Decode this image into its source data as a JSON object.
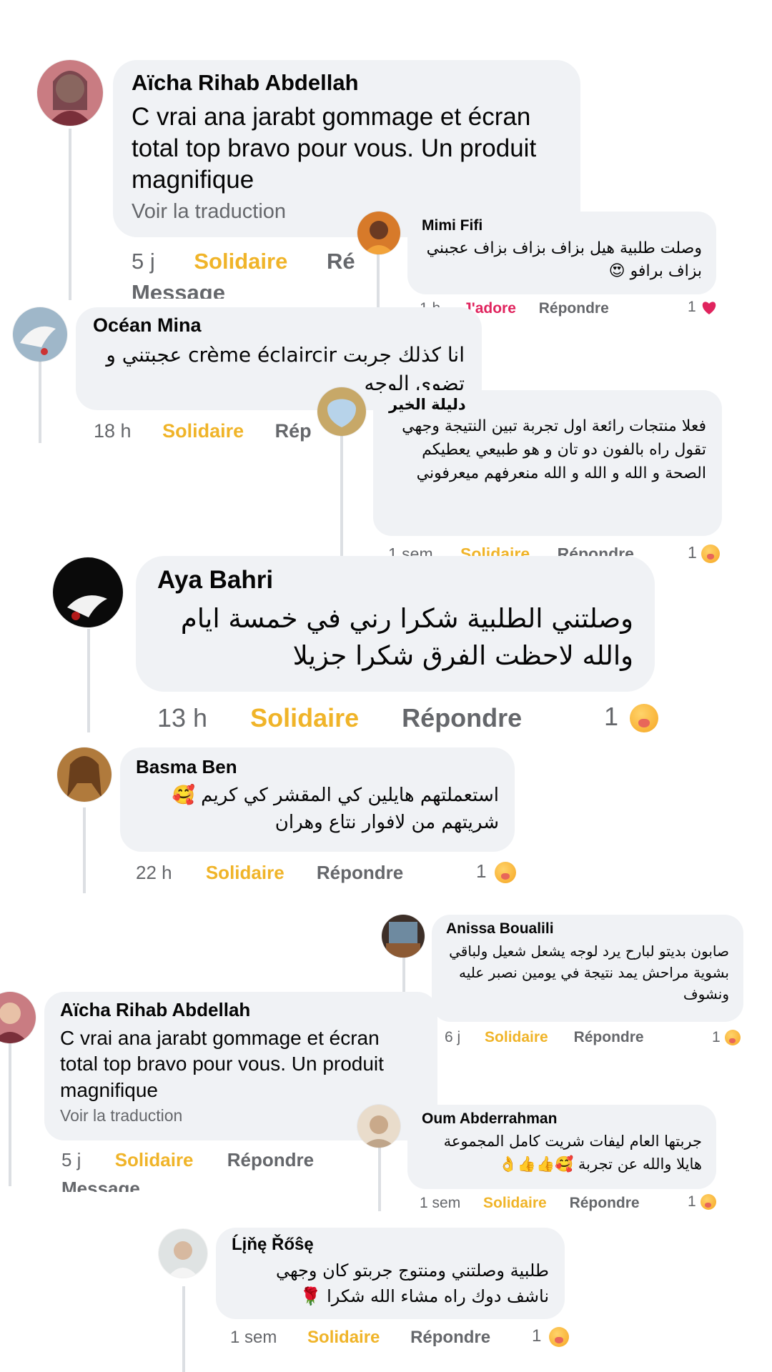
{
  "comments": [
    {
      "name": "Aïcha Rihab Abdellah",
      "text": "C vrai ana jarabt gommage et écran total top bravo pour vous. Un produit magnifique",
      "translate": "Voir la traduction",
      "time": "5 j",
      "solidaire": "Solidaire",
      "reply": "Ré",
      "overflow": "Message"
    },
    {
      "name": "Mimi Fifi",
      "text": "وصلت طلبية هيل بزاف بزاف بزاف عجبني بزاف برافو 😍",
      "time": "1 h",
      "react_label": "J'adore",
      "reply": "Répondre",
      "count": "1",
      "react_color": "#e0245e"
    },
    {
      "name": "Océan Mina",
      "text": "انا كذلك جربت crème éclaircir عجبتني و تضوي الوجه",
      "time": "18 h",
      "solidaire": "Solidaire",
      "reply": "Rép"
    },
    {
      "name": "دليلة الخير",
      "text": "فعلا منتجات رائعة اول تجربة تبين النتيجة وجهي تقول راه بالفون دو تان و هو طبيعي يعطيكم الصحة و الله و الله و الله منعرفهم ميعرفوني",
      "time": "1 sem",
      "solidaire": "Solidaire",
      "reply": "Répondre",
      "count": "1"
    },
    {
      "name": "Aya Bahri",
      "text": "وصلتني الطلبية شكرا رني في خمسة ايام والله لاحظت الفرق شكرا جزيلا",
      "time": "13 h",
      "solidaire": "Solidaire",
      "reply": "Répondre",
      "count": "1"
    },
    {
      "name": "Basma Ben",
      "text": "استعملتهم هايلين كي المقشر كي كريم 🥰 شريتهم من لافوار نتاع وهران",
      "time": "22 h",
      "solidaire": "Solidaire",
      "reply": "Répondre",
      "count": "1"
    },
    {
      "name": "Anissa Boualili",
      "text": "صابون بديتو لبارح يرد لوجه يشعل شعيل ولباقي بشوية مراحش يمد نتيجة في يومين نصبر عليه ونشوف",
      "time": "6 j",
      "solidaire": "Solidaire",
      "reply": "Répondre",
      "count": "1"
    },
    {
      "name": "Aïcha Rihab Abdellah",
      "text": "C vrai ana jarabt gommage et écran total top bravo pour vous. Un produit magnifique",
      "translate": "Voir la traduction",
      "time": "5 j",
      "solidaire": "Solidaire",
      "reply": "Répondre",
      "overflow": "Message"
    },
    {
      "name": "Oum Abderrahman",
      "text": "جربتها العام ليفات شريت كامل المجموعة هايلا والله عن تجربة 🥰👍👍👌",
      "time": "1 sem",
      "solidaire": "Solidaire",
      "reply": "Répondre",
      "count": "1"
    },
    {
      "name": "Ĺįňę Řőŝę",
      "text": "طلبية وصلتني ومنتوج جربتو كان وجهي ناشف دوك راه مشاء الله شكرا 🌹",
      "time": "1 sem",
      "solidaire": "Solidaire",
      "reply": "Répondre",
      "count": "1"
    }
  ],
  "icons": {
    "reaction": "thinking-face-icon",
    "love_reaction": "heart-icon"
  },
  "colors": {
    "solidaire": "#f0b429",
    "love": "#e0245e",
    "bubble": "#f0f2f5",
    "meta": "#65676b"
  }
}
